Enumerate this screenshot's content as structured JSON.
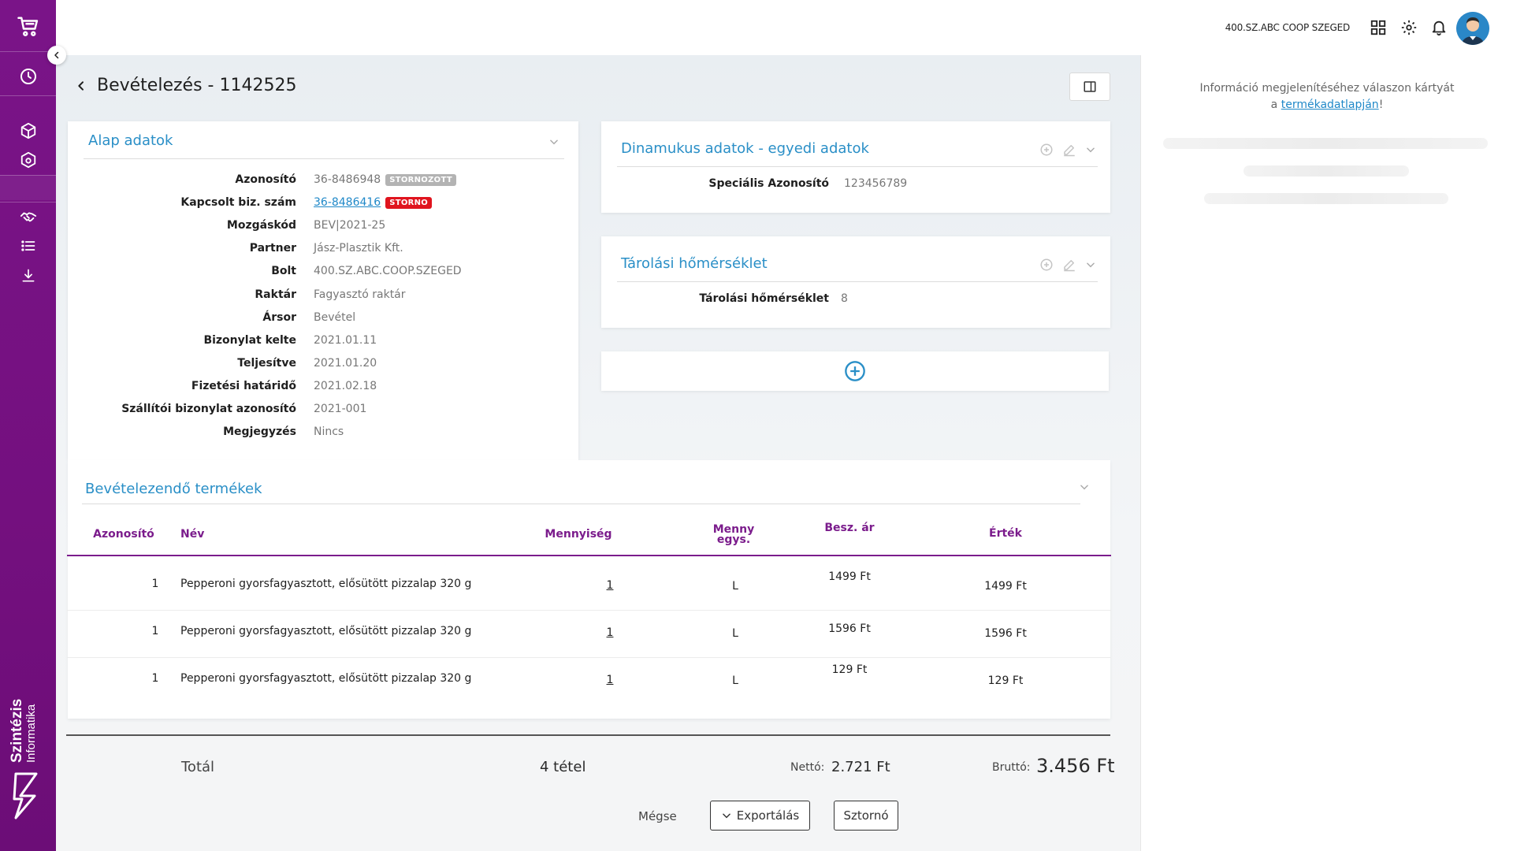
{
  "sidebar": {
    "brand": {
      "main": "Szintézis",
      "sub": "Informatika"
    },
    "icons": [
      "cart-icon",
      "clock-icon",
      "cube-icon",
      "cube-settings-icon",
      "handshake-icon",
      "list-icon",
      "download-icon"
    ]
  },
  "topbar": {
    "store_name": "400.SZ.ABC COOP SZEGED",
    "icons": [
      "grid-icon",
      "gear-icon",
      "bell-icon"
    ]
  },
  "page": {
    "title": "Bevételezés - 1142525"
  },
  "basic_data": {
    "title": "Alap adatok",
    "fields": [
      {
        "label": "Azonosító",
        "value": "36-8486948",
        "badge": "STORNOZOTT"
      },
      {
        "label": "Kapcsolt biz. szám",
        "value": "36-8486416",
        "badge": "STORNO"
      },
      {
        "label": "Mozgáskód",
        "value": "BEV|2021-25"
      },
      {
        "label": "Partner",
        "value": "Jász-Plasztik Kft."
      },
      {
        "label": "Bolt",
        "value": "400.SZ.ABC.COOP.SZEGED"
      },
      {
        "label": "Raktár",
        "value": "Fagyasztó raktár"
      },
      {
        "label": "Ársor",
        "value": "Bevétel"
      },
      {
        "label": "Bizonylat kelte",
        "value": "2021.01.11"
      },
      {
        "label": "Teljesítve",
        "value": "2021.01.20"
      },
      {
        "label": "Fizetési határidő",
        "value": "2021.02.18"
      },
      {
        "label": "Szállítói bizonylat azonosító",
        "value": "2021-001"
      },
      {
        "label": "Megjegyzés",
        "value": "Nincs"
      }
    ],
    "badge_colors": {
      "STORNOZOTT": "#b3b3b3",
      "STORNO": "#e0141e"
    }
  },
  "dynamic_data": {
    "title": "Dinamukus adatok - egyedi adatok",
    "label": "Speciális Azonosító",
    "value": "123456789"
  },
  "storage_temp": {
    "title": "Tárolási hőmérséklet",
    "label": "Tárolási hőmérséklet",
    "value": "8"
  },
  "products": {
    "title": "Bevételezendő termékek",
    "headers": {
      "id": "Azonosító",
      "name": "Név",
      "qty": "Mennyiség",
      "unit_1": "Menny",
      "unit_2": "egys.",
      "price": "Besz. ár",
      "value": "Érték"
    },
    "rows": [
      {
        "id": "1",
        "name": "Pepperoni gyorsfagyasztott, elősütött pizzalap 320 g",
        "qty": "1",
        "unit": "L",
        "price": "1499 Ft",
        "value": "1499 Ft"
      },
      {
        "id": "1",
        "name": "Pepperoni gyorsfagyasztott, elősütött pizzalap 320 g",
        "qty": "1",
        "unit": "L",
        "price": "1596 Ft",
        "value": "1596 Ft"
      },
      {
        "id": "1",
        "name": "Pepperoni gyorsfagyasztott, elősütött pizzalap 320 g",
        "qty": "1",
        "unit": "L",
        "price": "129 Ft",
        "value": "129 Ft"
      }
    ]
  },
  "totals": {
    "label": "Totál",
    "items": "4 tétel",
    "net_label": "Nettó:",
    "net_value": "2.721 Ft",
    "gross_label": "Bruttó:",
    "gross_value": "3.456 Ft"
  },
  "actions": {
    "cancel": "Mégse",
    "export": "Exportálás",
    "storno": "Sztornó"
  },
  "right_panel": {
    "text_1": "Információ megjelenítéséhez válaszon kártyát",
    "text_2_prefix": "a",
    "link": "termékadatlapján",
    "text_2_suffix": "!"
  },
  "colors": {
    "sidebar": "#7a1488",
    "accent_blue": "#2a8fc7",
    "table_header": "#7b1c8c",
    "storno_red": "#e0141e"
  }
}
